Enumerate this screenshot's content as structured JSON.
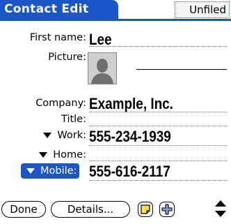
{
  "header": {
    "title": "Contact Edit",
    "category": "Unfiled"
  },
  "fields": {
    "first_name": {
      "label": "First name:",
      "value": "Lee"
    },
    "picture": {
      "label": "Picture:"
    },
    "company": {
      "label": "Company:",
      "value": "Example, Inc."
    },
    "title": {
      "label": "Title:",
      "value": ""
    },
    "work": {
      "label": "Work:",
      "value": "555-234-1939"
    },
    "home": {
      "label": "Home:",
      "value": ""
    },
    "mobile": {
      "label": "Mobile:",
      "value": "555-616-2117"
    }
  },
  "buttons": {
    "done": "Done",
    "details": "Details..."
  },
  "icons": {
    "note": "note-icon",
    "add": "plus-icon",
    "scroll": "scroll-arrows-icon",
    "dropdown": "dropdown-triangle-icon",
    "placeholder": "person-silhouette-icon"
  },
  "colors": {
    "accent": "#1a56c8",
    "background": "#ffffff"
  }
}
